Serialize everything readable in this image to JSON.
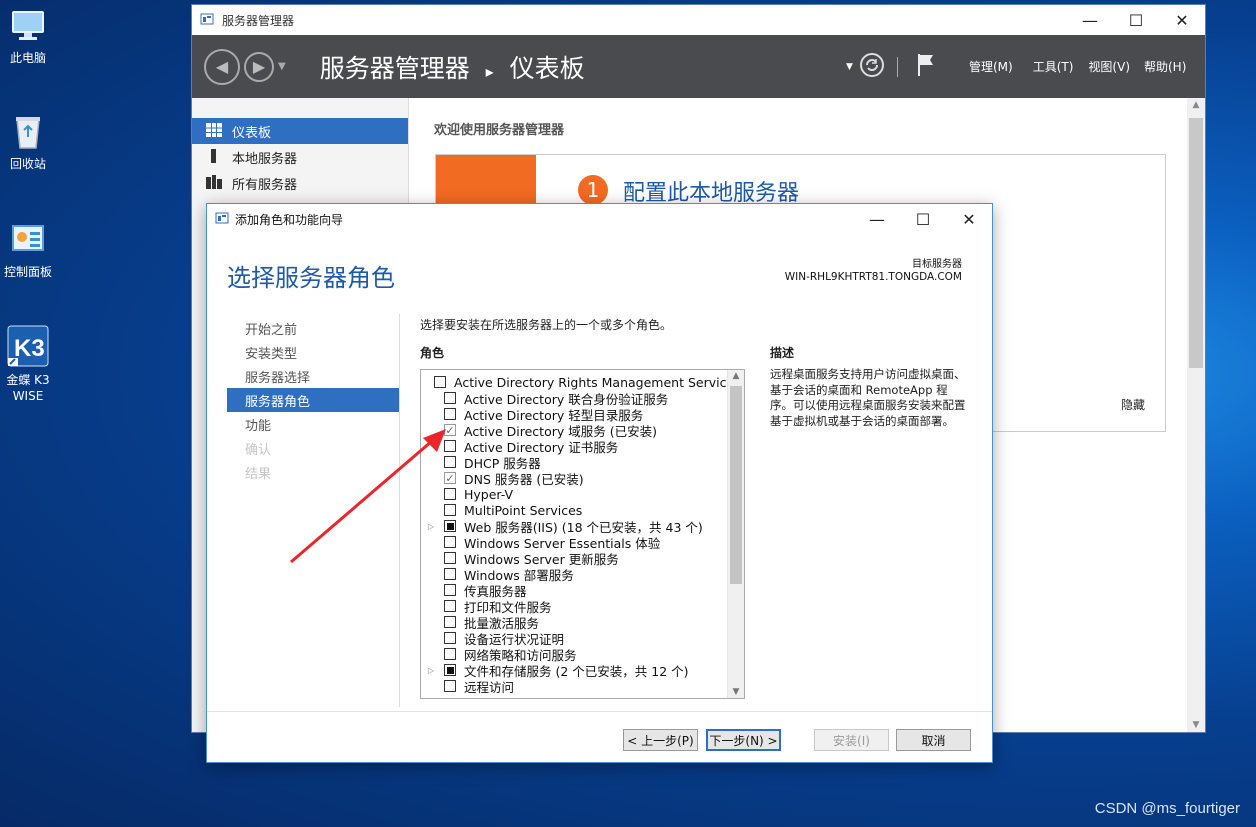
{
  "desktop": {
    "icons": [
      {
        "label": "此电脑",
        "icon": "computer-icon"
      },
      {
        "label": "回收站",
        "icon": "recycle-bin-icon"
      },
      {
        "label": "控制面板",
        "icon": "control-panel-icon"
      },
      {
        "label": "金蝶 K3 WISE",
        "icon": "kingdee-k3-icon"
      }
    ],
    "watermark": "CSDN @ms_fourtiger"
  },
  "server_manager": {
    "window_title": "服务器管理器",
    "breadcrumb_app": "服务器管理器",
    "breadcrumb_sep": "▸",
    "breadcrumb_page": "仪表板",
    "menu": {
      "manage": "管理(M)",
      "tools": "工具(T)",
      "view": "视图(V)",
      "help": "帮助(H)"
    },
    "nav": [
      {
        "label": "仪表板"
      },
      {
        "label": "本地服务器"
      },
      {
        "label": "所有服务器"
      }
    ],
    "welcome": "欢迎使用服务器管理器",
    "quickstart_number": "1",
    "quickstart_label": "配置此本地服务器",
    "hide_label": "隐藏"
  },
  "wizard": {
    "window_title": "添加角色和功能向导",
    "heading": "选择服务器角色",
    "target_label": "目标服务器",
    "target_server": "WIN-RHL9KHTRT81.TONGDA.COM",
    "steps": [
      {
        "label": "开始之前",
        "state": "normal"
      },
      {
        "label": "安装类型",
        "state": "normal"
      },
      {
        "label": "服务器选择",
        "state": "normal"
      },
      {
        "label": "服务器角色",
        "state": "active"
      },
      {
        "label": "功能",
        "state": "normal"
      },
      {
        "label": "确认",
        "state": "disabled"
      },
      {
        "label": "结果",
        "state": "disabled"
      }
    ],
    "instruction": "选择要安装在所选服务器上的一个或多个角色。",
    "roles_header": "角色",
    "roles": [
      {
        "label": "Active Directory Rights Management Services",
        "state": "unchecked",
        "expandable": false
      },
      {
        "label": "Active Directory 联合身份验证服务",
        "state": "unchecked",
        "expandable": false
      },
      {
        "label": "Active Directory 轻型目录服务",
        "state": "unchecked",
        "expandable": false
      },
      {
        "label": "Active Directory 域服务 (已安装)",
        "state": "checked",
        "expandable": false
      },
      {
        "label": "Active Directory 证书服务",
        "state": "unchecked",
        "expandable": false
      },
      {
        "label": "DHCP 服务器",
        "state": "unchecked",
        "expandable": false
      },
      {
        "label": "DNS 服务器 (已安装)",
        "state": "checked",
        "expandable": false
      },
      {
        "label": "Hyper-V",
        "state": "unchecked",
        "expandable": false
      },
      {
        "label": "MultiPoint Services",
        "state": "unchecked",
        "expandable": false
      },
      {
        "label": "Web 服务器(IIS) (18 个已安装，共 43 个)",
        "state": "partial",
        "expandable": true
      },
      {
        "label": "Windows Server Essentials 体验",
        "state": "unchecked",
        "expandable": false
      },
      {
        "label": "Windows Server 更新服务",
        "state": "unchecked",
        "expandable": false
      },
      {
        "label": "Windows 部署服务",
        "state": "unchecked",
        "expandable": false
      },
      {
        "label": "传真服务器",
        "state": "unchecked",
        "expandable": false
      },
      {
        "label": "打印和文件服务",
        "state": "unchecked",
        "expandable": false
      },
      {
        "label": "批量激活服务",
        "state": "unchecked",
        "expandable": false
      },
      {
        "label": "设备运行状况证明",
        "state": "unchecked",
        "expandable": false
      },
      {
        "label": "网络策略和访问服务",
        "state": "unchecked",
        "expandable": false
      },
      {
        "label": "文件和存储服务 (2 个已安装，共 12 个)",
        "state": "partial",
        "expandable": true
      },
      {
        "label": "远程访问",
        "state": "unchecked",
        "expandable": false
      }
    ],
    "description_header": "描述",
    "description": "远程桌面服务支持用户访问虚拟桌面、基于会话的桌面和 RemoteApp 程序。可以使用远程桌面服务安装来配置基于虚拟机或基于会话的桌面部署。",
    "buttons": {
      "prev": "< 上一步(P)",
      "next": "下一步(N) >",
      "install": "安装(I)",
      "cancel": "取消"
    }
  },
  "colors": {
    "accent": "#2f6fc1",
    "header": "#494b4e",
    "orange": "#f26b22",
    "arrow": "#e8262b"
  }
}
